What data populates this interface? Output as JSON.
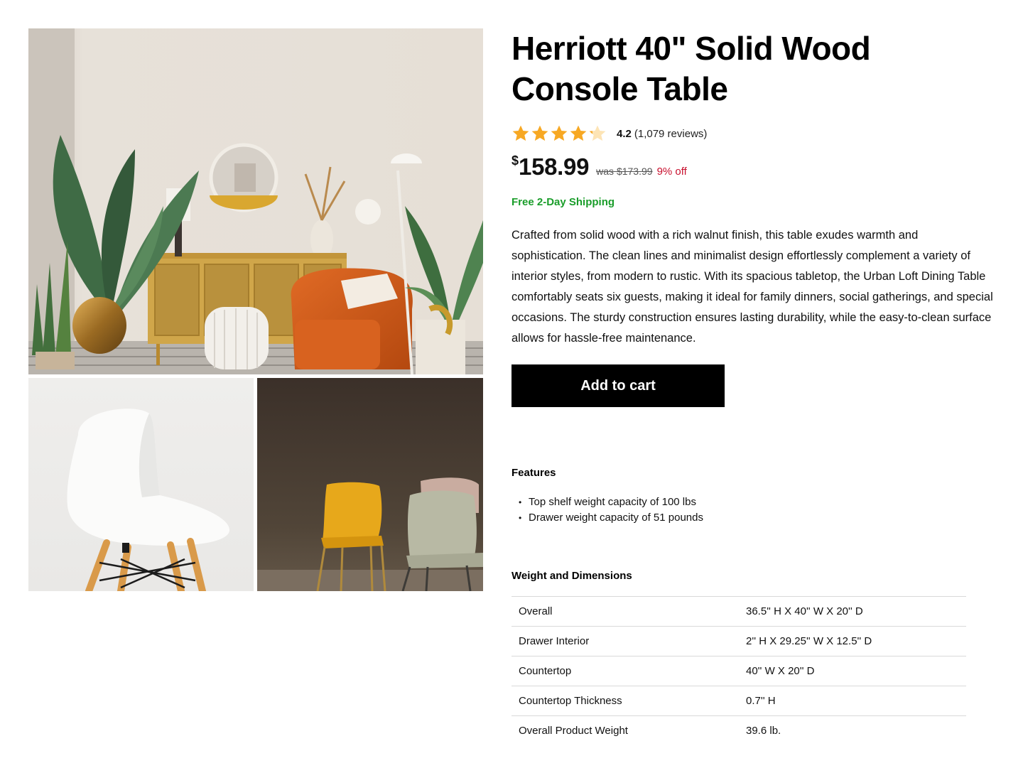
{
  "product": {
    "title": "Herriott 40\" Solid Wood Console Table",
    "rating_value": "4.2",
    "rating_score": 4.2,
    "rating_max": 5,
    "review_count": "(1,079 reviews)",
    "currency_symbol": "$",
    "price": "158.99",
    "was_price": "was $173.99",
    "discount": "9% off",
    "shipping": "Free 2-Day Shipping",
    "description": "Crafted from solid wood with a rich walnut finish, this table exudes warmth and sophistication. The clean lines and minimalist design effortlessly complement a variety of interior styles, from modern to rustic. With its spacious tabletop, the Urban Loft Dining Table comfortably seats six guests, making it ideal for family dinners, social gatherings, and special occasions. The sturdy construction ensures lasting durability, while the easy-to-clean surface allows for hassle-free maintenance.",
    "add_to_cart_label": "Add to cart"
  },
  "features": {
    "heading": "Features",
    "items": [
      "Top shelf weight capacity of 100 lbs",
      "Drawer weight capacity of 51 pounds"
    ]
  },
  "dimensions": {
    "heading": "Weight and Dimensions",
    "rows": [
      {
        "label": "Overall",
        "value": "36.5'' H X 40'' W X 20'' D"
      },
      {
        "label": "Drawer Interior",
        "value": "2'' H X 29.25'' W X 12.5'' D"
      },
      {
        "label": "Countertop",
        "value": "40'' W X 20'' D"
      },
      {
        "label": "Countertop Thickness",
        "value": "0.7'' H"
      },
      {
        "label": "Overall Product Weight",
        "value": "39.6 lb."
      }
    ]
  },
  "colors": {
    "star": "#f7a823",
    "star_empty": "#fde4b5",
    "shipping_green": "#1a9d2a",
    "discount_red": "#c8102e",
    "button_bg": "#000000"
  },
  "gallery": {
    "images": [
      {
        "subject": "living-room-photo"
      },
      {
        "subject": "white-chair-photo"
      },
      {
        "subject": "colored-chairs-photo"
      }
    ]
  }
}
